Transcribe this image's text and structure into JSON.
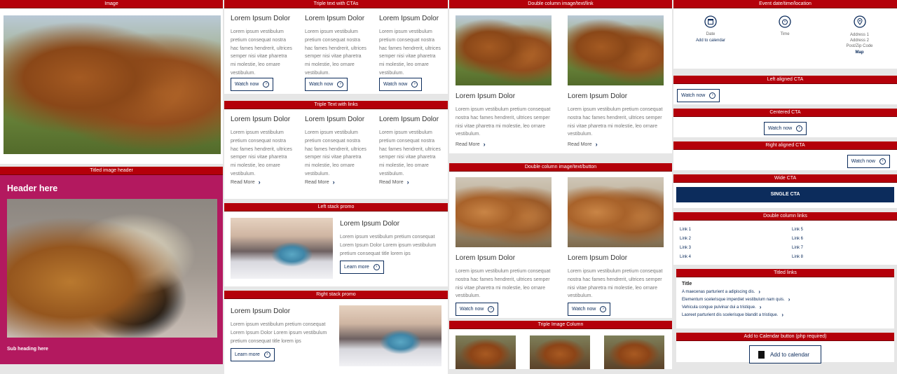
{
  "col1": {
    "image_bar": "Image",
    "titled_bar": "Titled image header",
    "header": "Header here",
    "subheading": "Sub heading here"
  },
  "col2": {
    "triple_cta_bar": "Triple text with CTAs",
    "triple_links_bar": "Triple Text with links",
    "left_stack_bar": "Left stack promo",
    "right_stack_bar": "Right stack promo",
    "heading": "Lorem Ipsum Dolor",
    "body": "Lorem ipsum vestibulum pretium consequat nostra hac fames hendrerit, ultrices semper nisi vitae pharetra mi molestie, leo ornare vestibulum.",
    "watch": "Watch now",
    "read_more": "Read More",
    "promo_body": "Lorem ipsum vestibulum pretium consequat Lorem Ipsum Dolor Lorem ipsum vestibulum pretium consequat title lorem ips",
    "learn_more": "Learn more"
  },
  "col3": {
    "dc_link_bar": "Double column image/text/link",
    "dc_button_bar": "Double column image/text/button",
    "triple_image_bar": "Triple Image Column",
    "heading": "Lorem Ipsum Dolor",
    "body": "Lorem ipsum vestibulum pretium consequat nostra hac fames hendrerit, ultrices semper nisi vitae pharetra mi molestie, leo ornare vestibulum.",
    "read_more": "Read More",
    "watch": "Watch now"
  },
  "col4": {
    "event_bar": "Event date/time/location",
    "date": "Date",
    "add_calendar": "Add to calendar",
    "time": "Time",
    "addr1": "Address 1",
    "addr2": "Address 2",
    "postcode": "Post/Zip Code",
    "map": "Map",
    "left_cta_bar": "Left aligned CTA",
    "center_cta_bar": "Centered CTA",
    "right_cta_bar": "Right aligned CTA",
    "watch": "Watch now",
    "wide_cta_bar": "Wide CTA",
    "single_cta": "SINGLE CTA",
    "dc_links_bar": "Double column links",
    "links_left": [
      "Link 1",
      "Link 2",
      "Link 3",
      "Link 4"
    ],
    "links_right": [
      "Link 5",
      "Link 6",
      "Link 7",
      "Link 8"
    ],
    "titled_links_bar": "Titled links",
    "titled_title": "Title",
    "titled_links": [
      "A maecenas parturient a adipiscing dis.",
      "Elementum scelerisque imperdiet vestibulum nam quis.",
      "Vehicula congue pulvinar dui a tristique.",
      "Laoreet parturient dis scelerisque blandit a tristique."
    ],
    "calendar_bar": "Add to Calendar button (php required)",
    "calendar_button": "Add to calendar"
  },
  "colors": {
    "bar": "#b4000a",
    "navy": "#0c2c5c",
    "magenta": "#b3195f"
  }
}
